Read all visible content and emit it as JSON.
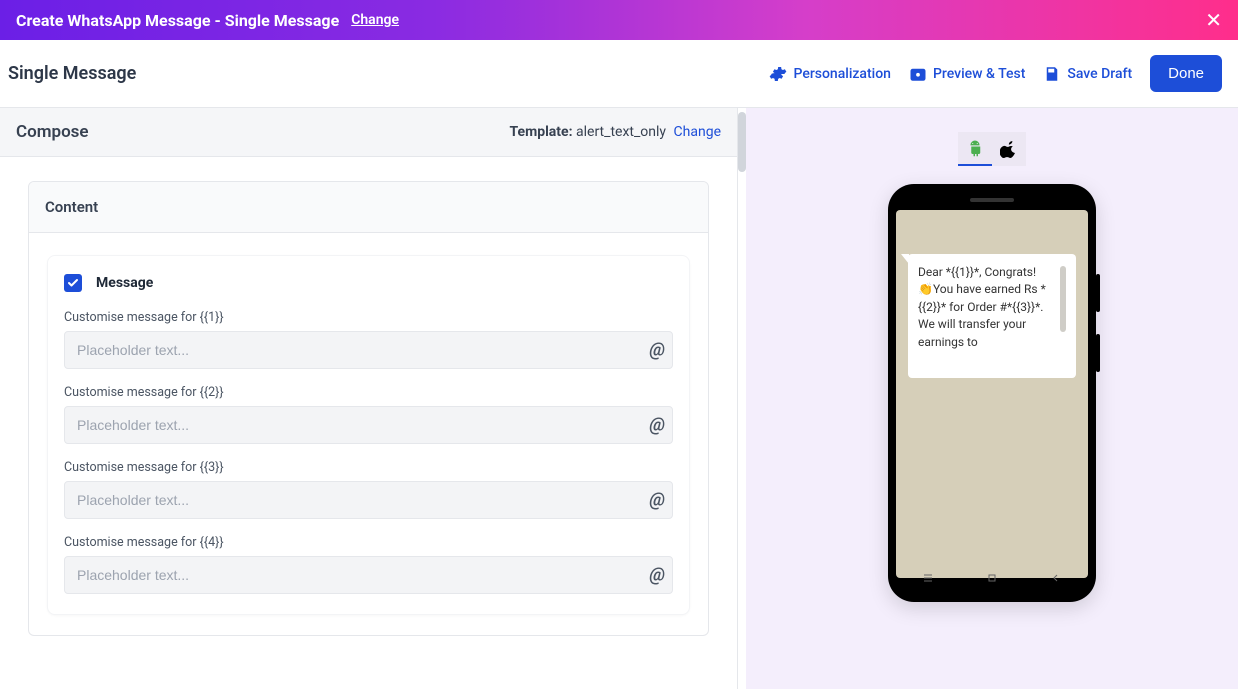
{
  "topbar": {
    "title": "Create WhatsApp Message - Single Message",
    "change": "Change"
  },
  "subheader": {
    "title": "Single Message",
    "personalization": "Personalization",
    "preview_test": "Preview & Test",
    "save_draft": "Save Draft",
    "done": "Done"
  },
  "compose": {
    "label": "Compose",
    "template_label": "Template:",
    "template_name": "alert_text_only",
    "template_change": "Change"
  },
  "content": {
    "title": "Content",
    "message_title": "Message",
    "fields": [
      {
        "label": "Customise message for {{1}}",
        "placeholder": "Placeholder text..."
      },
      {
        "label": "Customise message for {{2}}",
        "placeholder": "Placeholder text..."
      },
      {
        "label": "Customise message for {{3}}",
        "placeholder": "Placeholder text..."
      },
      {
        "label": "Customise message for {{4}}",
        "placeholder": "Placeholder text..."
      }
    ],
    "at": "@"
  },
  "preview": {
    "message": "Dear *{{1}}*, Congrats! 👏You have earned Rs *{{2}}* for Order #*{{3}}*. We will transfer your earnings to"
  }
}
